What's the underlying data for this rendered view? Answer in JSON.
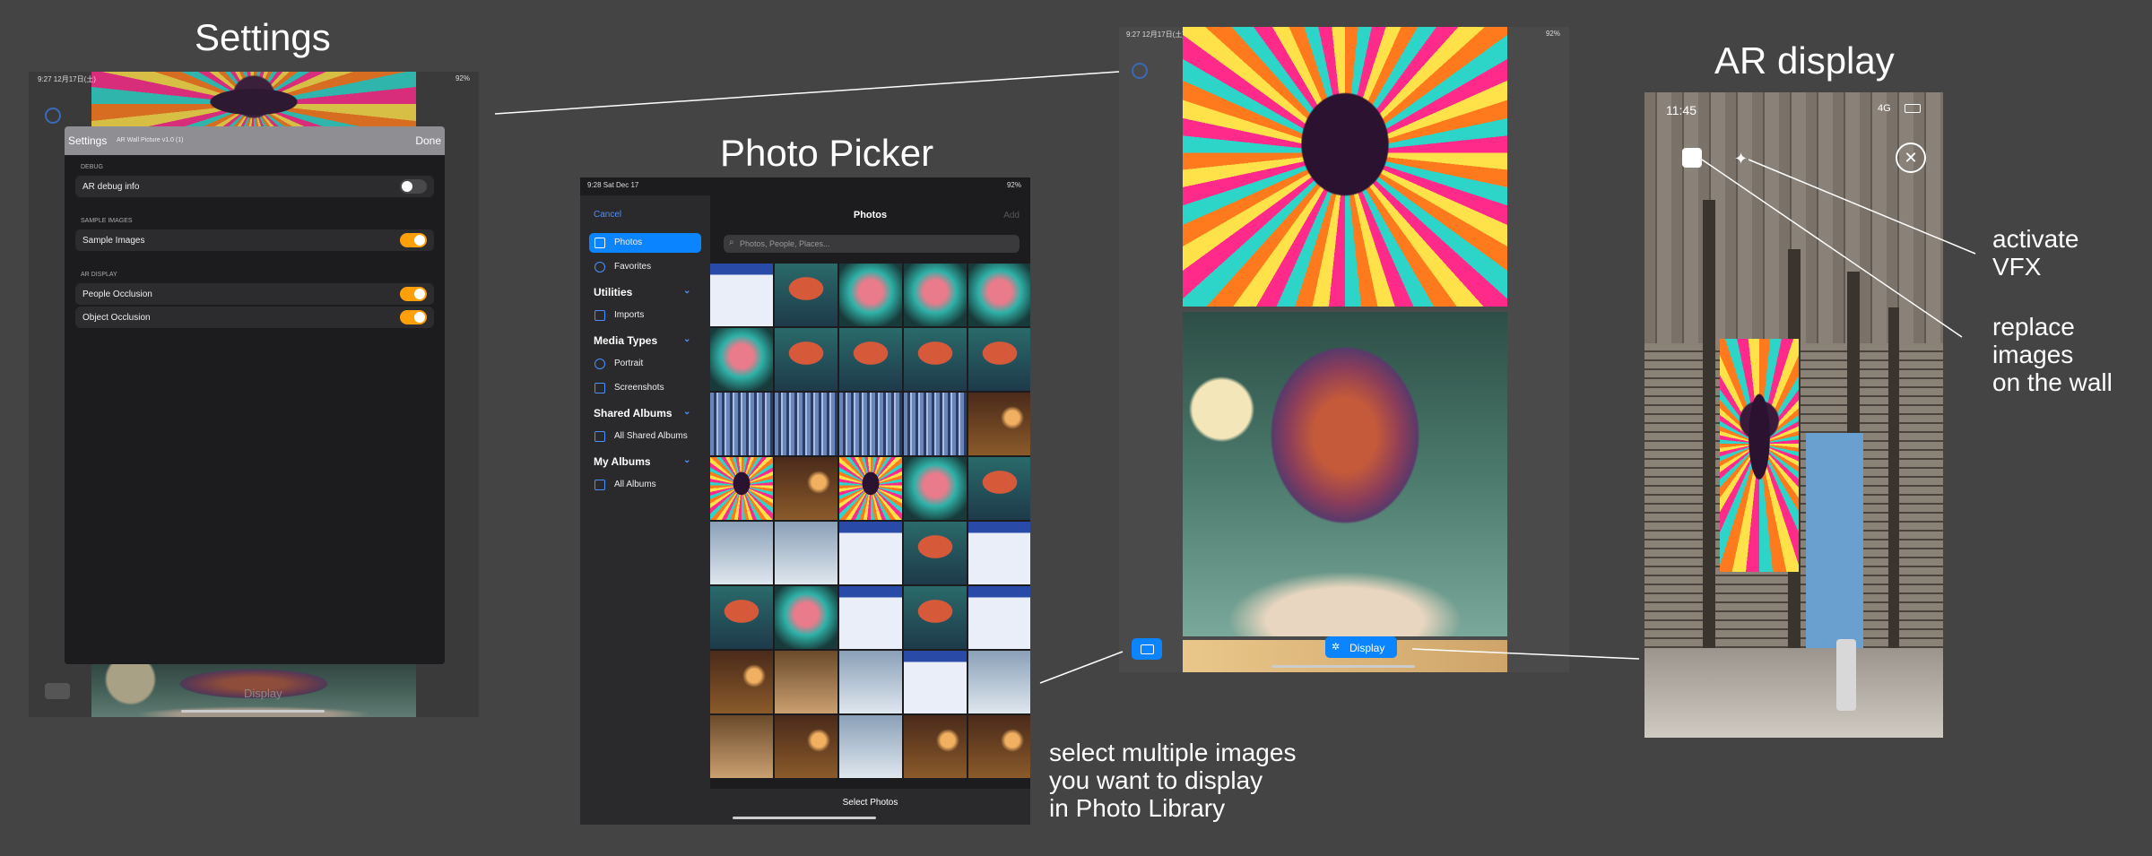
{
  "labels": {
    "settings": "Settings",
    "photo_picker": "Photo Picker",
    "ar_display": "AR display",
    "activate_vfx": [
      "activate",
      "VFX"
    ],
    "replace_images": [
      "replace",
      "images",
      "on the wall"
    ],
    "select_multiple": [
      "select  multiple images",
      "you want to display",
      "in Photo Library"
    ]
  },
  "settings_screen": {
    "status_time": "9:27  12月17日(土)",
    "status_right": "92%",
    "header_title": "Settings",
    "header_subtitle": "AR Wall Picture v1.0 (1)",
    "done": "Done",
    "sections": [
      {
        "title": "DEBUG",
        "rows": [
          {
            "label": "AR debug info",
            "on": false
          }
        ]
      },
      {
        "title": "SAMPLE IMAGES",
        "rows": [
          {
            "label": "Sample Images",
            "on": true
          }
        ]
      },
      {
        "title": "AR DISPLAY",
        "rows": [
          {
            "label": "People Occlusion",
            "on": true
          },
          {
            "label": "Object Occlusion",
            "on": true
          }
        ]
      }
    ],
    "display_button": "Display"
  },
  "picker": {
    "status_time": "9:28  Sat Dec 17",
    "status_right": "92%",
    "cancel": "Cancel",
    "title": "Photos",
    "add": "Add",
    "search_placeholder": "Photos, People, Places...",
    "side": {
      "photos": "Photos",
      "favorites": "Favorites",
      "utilities": "Utilities",
      "imports": "Imports",
      "media_types": "Media Types",
      "portrait": "Portrait",
      "screenshots": "Screenshots",
      "shared_albums": "Shared Albums",
      "all_shared_albums": "All Shared Albums",
      "my_albums": "My Albums",
      "all_albums": "All Albums"
    },
    "select_photos": "Select Photos"
  },
  "display_screen": {
    "status_time": "9:27  12月17日(土)",
    "status_right": "92%",
    "display_button": "Display"
  },
  "ar_phone": {
    "time": "11:45",
    "signal": "4G"
  }
}
